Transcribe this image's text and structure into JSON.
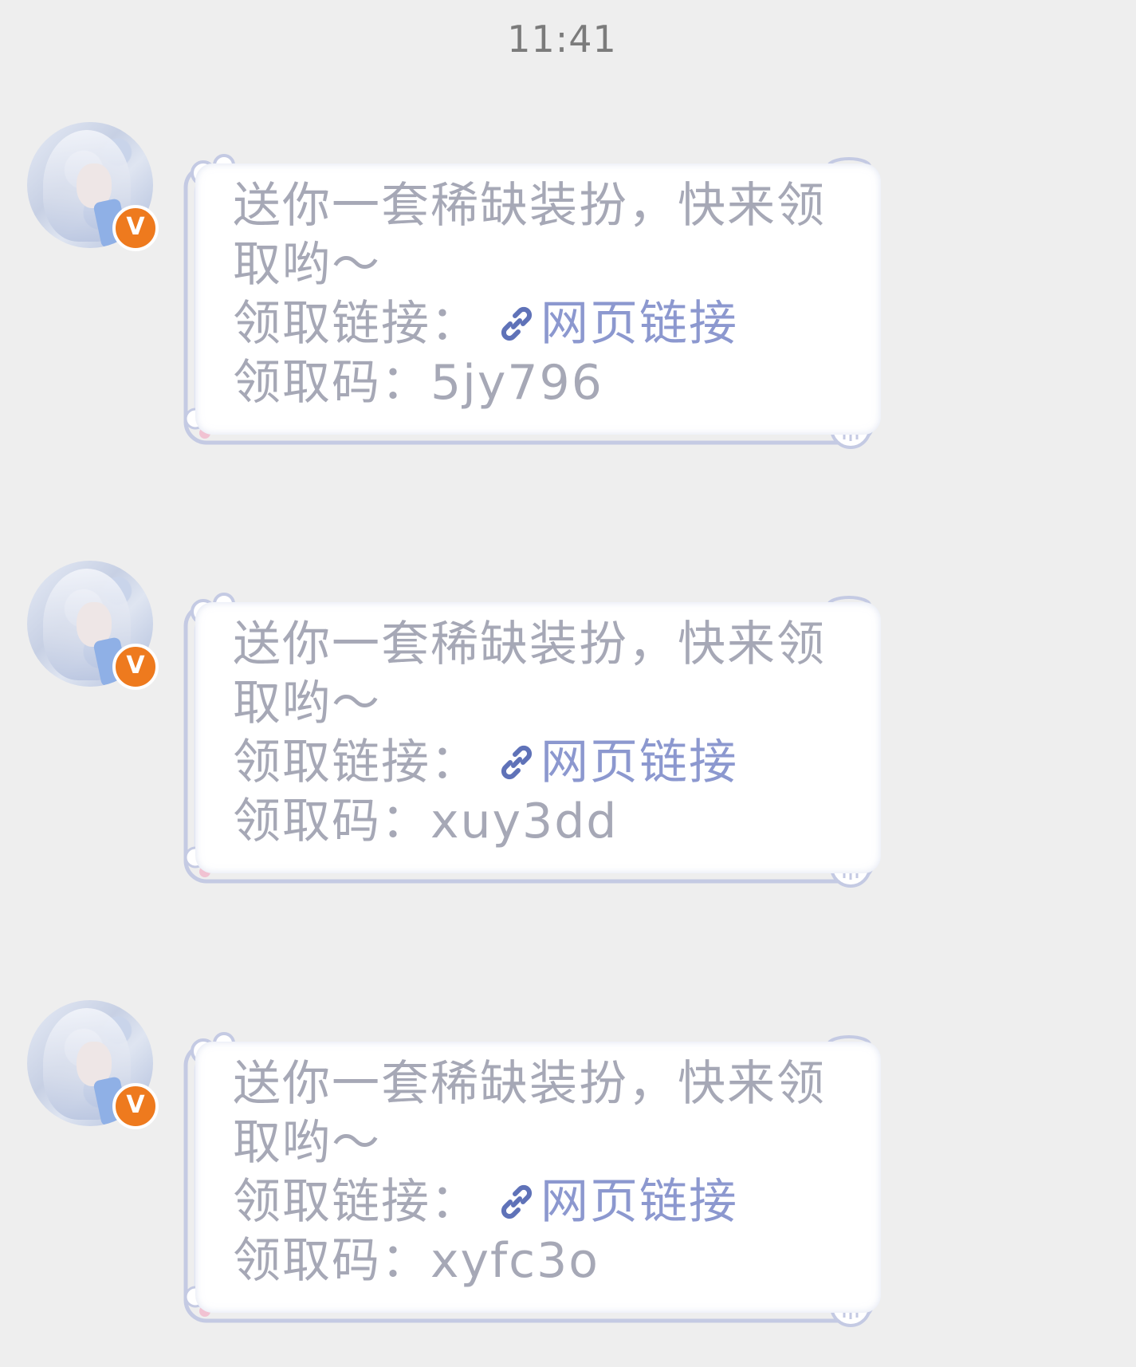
{
  "status": {
    "time": "11:41"
  },
  "messages": [
    {
      "text_line1": "送你一套稀缺装扮，快来领",
      "text_line2": "取哟～",
      "link_prefix": "领取链接：",
      "link_text": "网页链接",
      "code_prefix": "领取码：",
      "code": "5jy796"
    },
    {
      "text_line1": "送你一套稀缺装扮，快来领",
      "text_line2": "取哟～",
      "link_prefix": "领取链接：",
      "link_text": "网页链接",
      "code_prefix": "领取码：",
      "code": "xuy3dd"
    },
    {
      "text_line1": "送你一套稀缺装扮，快来领",
      "text_line2": "取哟～",
      "link_prefix": "领取链接：",
      "link_text": "网页链接",
      "code_prefix": "领取码：",
      "code": "xyfc3o"
    }
  ],
  "icons": {
    "avatar_badge": "v-verified-badge",
    "link": "link-chain-icon"
  },
  "colors": {
    "background": "#eeeeee",
    "text": "#a6a8b6",
    "link": "#8c98cf",
    "badge": "#ee7a1e",
    "frame": "#c4cae3"
  }
}
